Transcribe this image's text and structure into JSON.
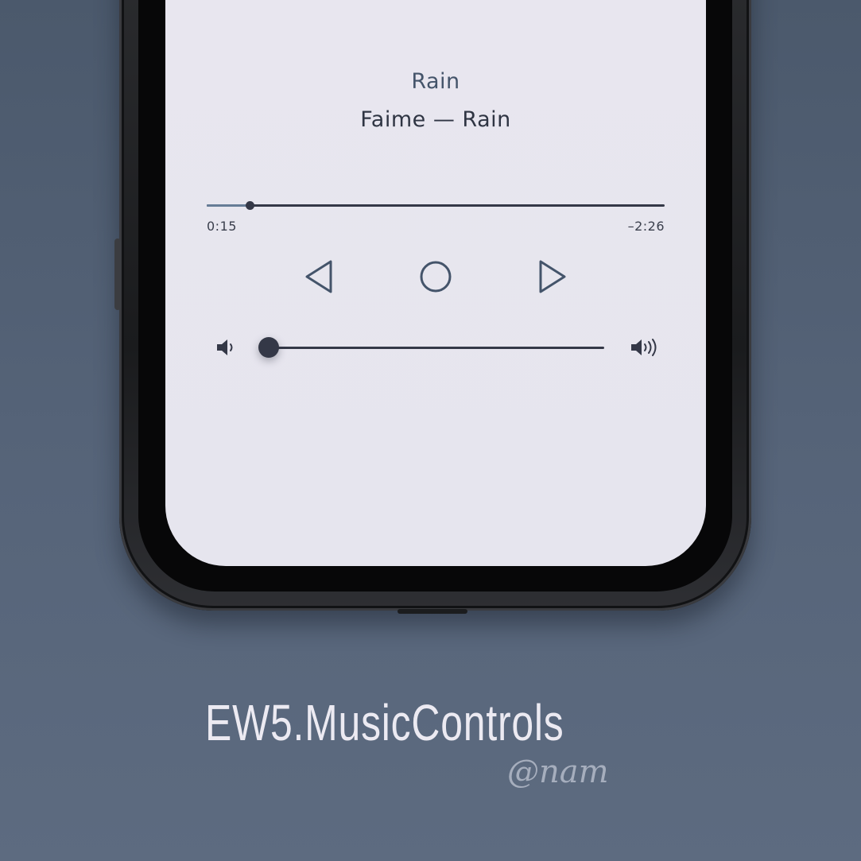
{
  "now_playing": {
    "title": "Rain",
    "subtitle": "Faime — Rain",
    "elapsed": "0:15",
    "remaining": "–2:26",
    "progress_fraction": 0.093
  },
  "controls": {
    "previous": "previous-triangle",
    "play_pause": "circle",
    "next": "next-triangle"
  },
  "volume": {
    "level_fraction": 0.0,
    "min_icon": "speaker-low-icon",
    "max_icon": "speaker-high-icon"
  },
  "branding": {
    "tweak_name": "EW5.MusicControls",
    "author": "@nam"
  },
  "colors": {
    "background": "#566479",
    "screen": "#e7e6ee",
    "accent": "#44546a",
    "dark": "#343847"
  }
}
